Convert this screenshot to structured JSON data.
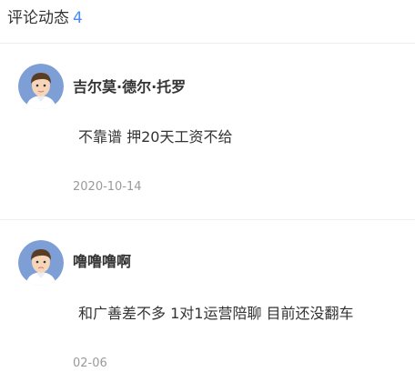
{
  "header": {
    "title": "评论动态",
    "count": "4"
  },
  "comments": [
    {
      "author": "吉尔莫·德尔·托罗",
      "content": "不靠谱 押20天工资不给",
      "date": "2020-10-14",
      "avatar_icon": "user-avatar-icon"
    },
    {
      "author": "噜噜噜啊",
      "content": "和广善差不多 1对1运营陪聊 目前还没翻车",
      "date": "02-06",
      "avatar_icon": "user-avatar-icon"
    }
  ],
  "colors": {
    "accent": "#4a8bf5",
    "text": "#333333",
    "muted": "#9a9a9a",
    "avatar_bg": "#7d9fd6"
  }
}
